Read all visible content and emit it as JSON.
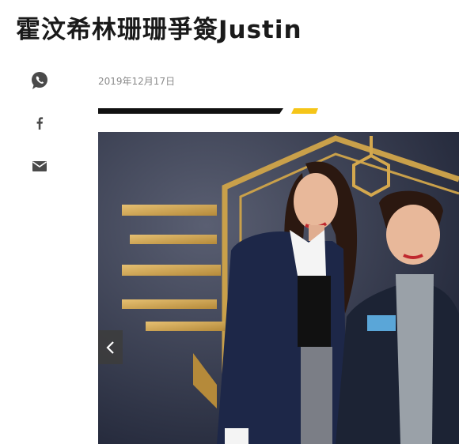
{
  "article": {
    "title": "霍汶希林珊珊爭簽Justin",
    "date": "2019年12月17日"
  },
  "share": {
    "items": [
      "whatsapp-icon",
      "facebook-icon",
      "email-icon"
    ]
  },
  "carousel": {
    "prev_icon": "chevron-left-icon"
  },
  "colors": {
    "accent_yellow": "#f5c518",
    "rule_black": "#111111",
    "icon_gray": "#4a4a4a"
  }
}
